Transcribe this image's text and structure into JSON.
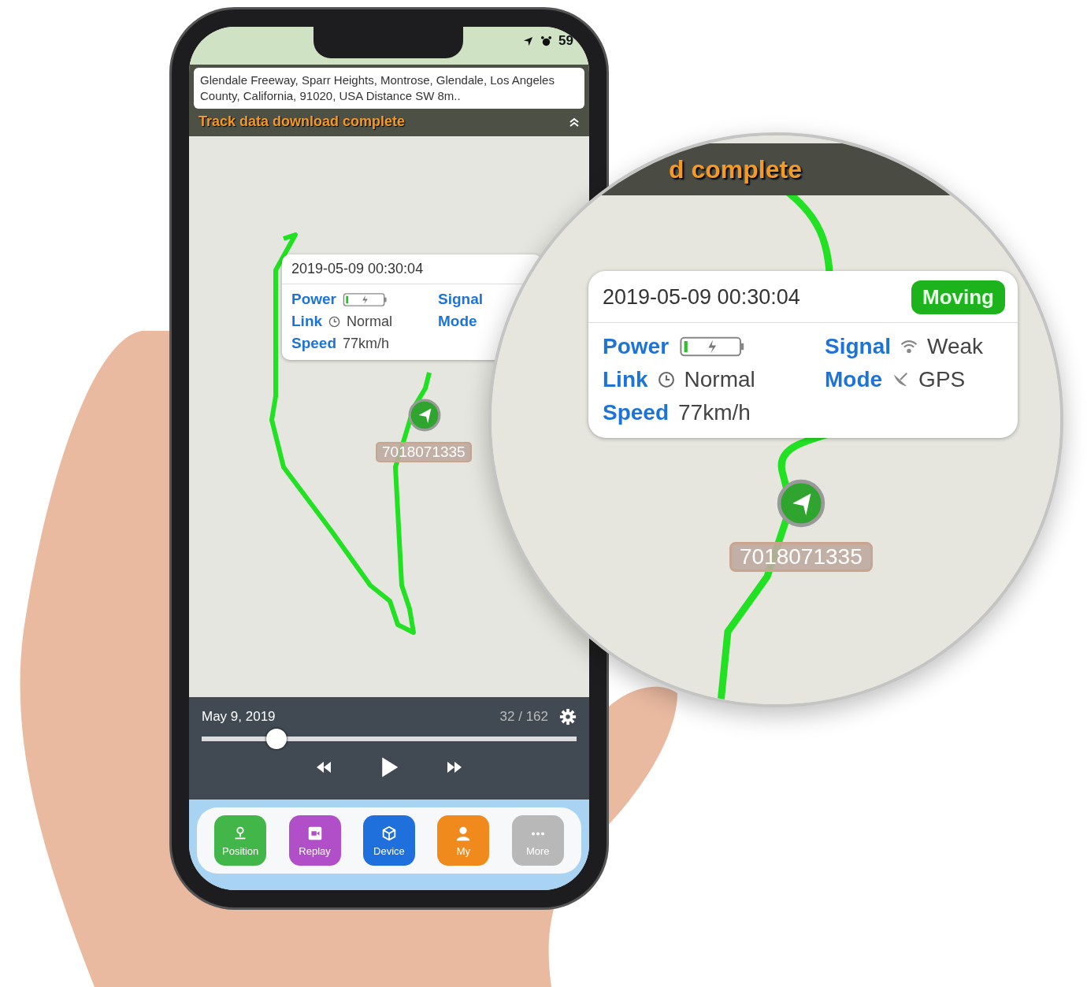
{
  "phone": {
    "status_bar": {
      "battery_text": "59"
    },
    "address": "Glendale Freeway, Sparr Heights, Montrose, Glendale, Los Angeles County, California, 91020, USA Distance SW 8m..",
    "banner": "Track data download complete",
    "popup": {
      "timestamp": "2019-05-09 00:30:04",
      "fields": [
        {
          "kind": "battery",
          "label": "Power"
        },
        {
          "kind": "plain",
          "label": "Signal"
        },
        {
          "kind": "clock",
          "label": "Link",
          "value": "Normal"
        },
        {
          "kind": "plain",
          "label": "Mode"
        },
        {
          "kind": "plain",
          "label": "Speed",
          "value": "77km/h"
        }
      ]
    },
    "device_label": "7018071335",
    "playback": {
      "date": "May 9, 2019",
      "counter": "32 / 162",
      "level": 0.2
    },
    "tabs": [
      {
        "kind": "pin",
        "label": "Position",
        "color": "#43b649"
      },
      {
        "kind": "video",
        "label": "Replay",
        "color": "#b04fc7"
      },
      {
        "kind": "cube",
        "label": "Device",
        "color": "#1f6fdc"
      },
      {
        "kind": "person",
        "label": "My",
        "color": "#f08a1c"
      },
      {
        "kind": "dots",
        "label": "More",
        "color": "#b8b8b8"
      }
    ]
  },
  "magnifier": {
    "banner": "d complete",
    "popup": {
      "timestamp": "2019-05-09 00:30:04",
      "status": "Moving",
      "fields": [
        {
          "kind": "battery",
          "label": "Power"
        },
        {
          "kind": "wifi",
          "label": "Signal",
          "value": "Weak"
        },
        {
          "kind": "clock",
          "label": "Link",
          "value": "Normal"
        },
        {
          "kind": "satellite",
          "label": "Mode",
          "value": "GPS"
        },
        {
          "kind": "plain",
          "label": "Speed",
          "value": "77km/h"
        }
      ]
    },
    "device_label": "7018071335"
  }
}
